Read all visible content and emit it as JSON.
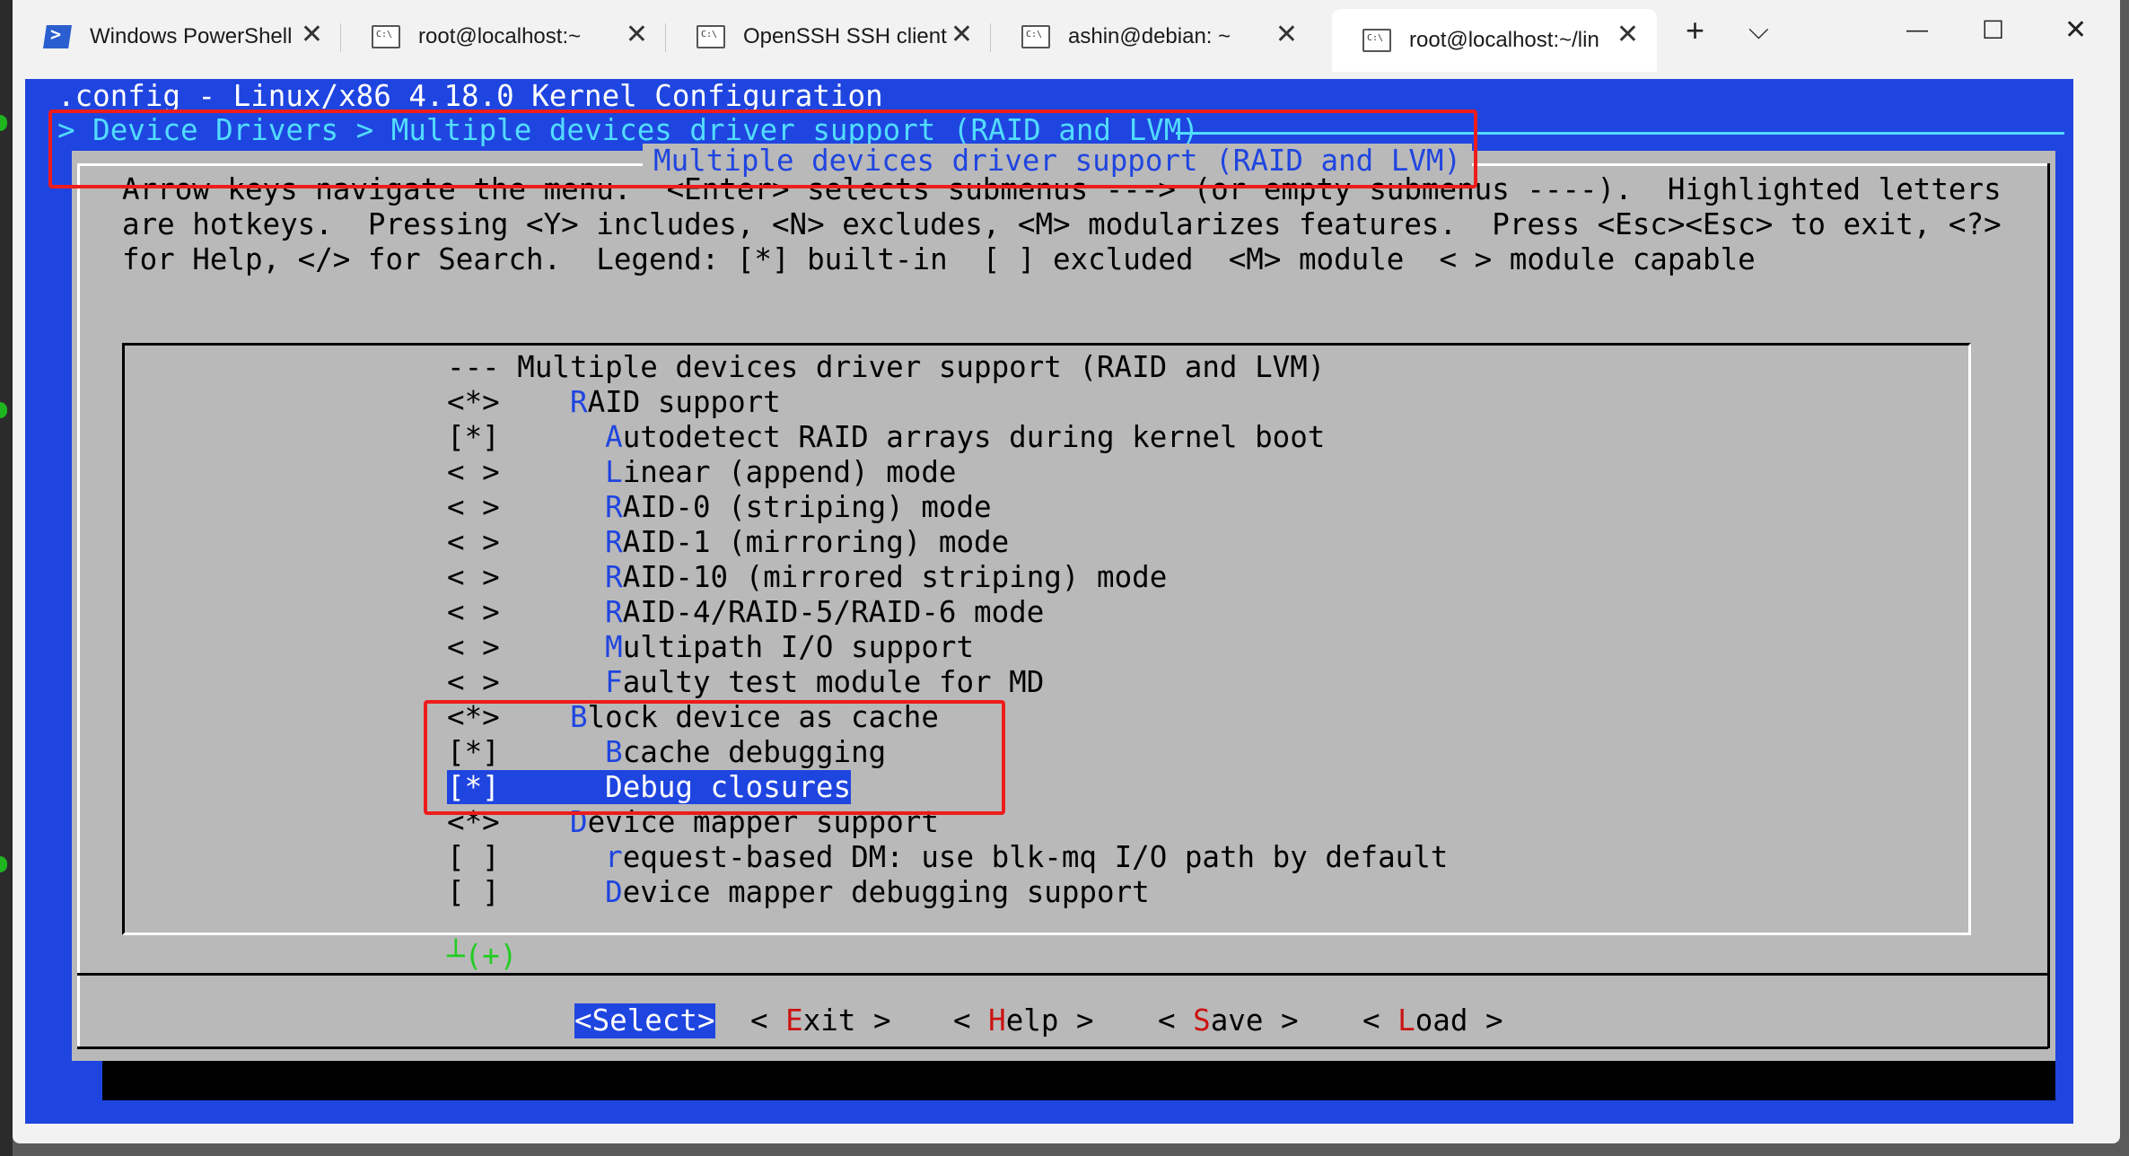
{
  "tabs": [
    {
      "label": "Windows PowerShell",
      "icon": "powershell-icon"
    },
    {
      "label": "root@localhost:~",
      "icon": "terminal-icon"
    },
    {
      "label": "OpenSSH SSH client",
      "icon": "terminal-icon"
    },
    {
      "label": "ashin@debian: ~",
      "icon": "terminal-icon"
    },
    {
      "label": "root@localhost:~/lin",
      "icon": "terminal-icon"
    }
  ],
  "tabbar": {
    "close": "✕",
    "new_tab": "+",
    "dropdown": "⌵"
  },
  "window": {
    "minimize": "—",
    "maximize": "☐",
    "close": "✕"
  },
  "terminal": {
    "config_title": ".config - Linux/x86 4.18.0 Kernel Configuration",
    "breadcrumb": "> Device Drivers > Multiple devices driver support (RAID and LVM)",
    "dialog_title": "Multiple devices driver support (RAID and LVM)",
    "help_lines": [
      "Arrow keys navigate the menu.  <Enter> selects submenus ---> (or empty submenus ----).  Highlighted letters",
      "are hotkeys.  Pressing <Y> includes, <N> excludes, <M> modularizes features.  Press <Esc><Esc> to exit, <?>",
      "for Help, </> for Search.  Legend: [*] built-in  [ ] excluded  <M> module  < > module capable"
    ],
    "menu_header": "--- Multiple devices driver support (RAID and LVM)",
    "items": [
      {
        "state": "<*>",
        "indent": "  ",
        "hotkey": "R",
        "rest": "AID support"
      },
      {
        "state": "[*]",
        "indent": "    ",
        "hotkey": "A",
        "rest": "utodetect RAID arrays during kernel boot"
      },
      {
        "state": "< >",
        "indent": "    ",
        "hotkey": "L",
        "rest": "inear (append) mode"
      },
      {
        "state": "< >",
        "indent": "    ",
        "hotkey": "R",
        "rest": "AID-0 (striping) mode"
      },
      {
        "state": "< >",
        "indent": "    ",
        "hotkey": "R",
        "rest": "AID-1 (mirroring) mode"
      },
      {
        "state": "< >",
        "indent": "    ",
        "hotkey": "R",
        "rest": "AID-10 (mirrored striping) mode"
      },
      {
        "state": "< >",
        "indent": "    ",
        "hotkey": "R",
        "rest": "AID-4/RAID-5/RAID-6 mode"
      },
      {
        "state": "< >",
        "indent": "    ",
        "hotkey": "M",
        "rest": "ultipath I/O support"
      },
      {
        "state": "< >",
        "indent": "    ",
        "hotkey": "F",
        "rest": "aulty test module for MD"
      },
      {
        "state": "<*>",
        "indent": "  ",
        "hotkey": "B",
        "rest": "lock device as cache"
      },
      {
        "state": "[*]",
        "indent": "    ",
        "hotkey": "B",
        "rest": "cache debugging"
      },
      {
        "state": "[*]",
        "indent": "    ",
        "hotkey": "D",
        "rest": "ebug closures",
        "selected": true
      },
      {
        "state": "<*>",
        "indent": "  ",
        "hotkey": "D",
        "rest": "evice mapper support"
      },
      {
        "state": "[ ]",
        "indent": "    ",
        "hotkey": "r",
        "rest": "equest-based DM: use blk-mq I/O path by default"
      },
      {
        "state": "[ ]",
        "indent": "    ",
        "hotkey": "D",
        "rest": "evice mapper debugging support"
      }
    ],
    "more_indicator": "┴(+)",
    "buttons": [
      {
        "pre": "<",
        "hotkey": "",
        "label": "Select",
        "post": ">",
        "active": true
      },
      {
        "pre": "< ",
        "hotkey": "E",
        "label": "xit",
        "post": " >"
      },
      {
        "pre": "< ",
        "hotkey": "H",
        "label": "elp",
        "post": " >"
      },
      {
        "pre": "< ",
        "hotkey": "S",
        "label": "ave",
        "post": " >"
      },
      {
        "pre": "< ",
        "hotkey": "L",
        "label": "oad",
        "post": " >"
      }
    ]
  },
  "colors": {
    "terminal_bg": "#1f45e0",
    "dialog_bg": "#b9b9b9",
    "hotkey_blue": "#1f45e0",
    "hotkey_red": "#cc1111",
    "breadcrumb_cyan": "#52dcff",
    "annotation_red": "#ee1c1c"
  }
}
